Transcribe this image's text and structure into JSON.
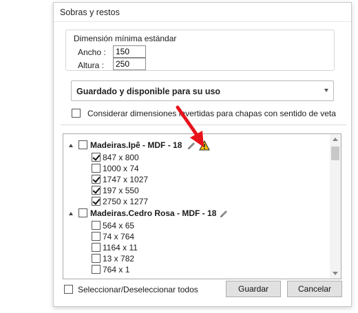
{
  "dialog": {
    "title": "Sobras y restos"
  },
  "min_dim": {
    "legend": "Dimensión mínima estándar",
    "width_label": "Ancho :",
    "width_value": "150",
    "height_label": "Altura :",
    "height_value": "250"
  },
  "storage_select": {
    "value": "Guardado y disponible para su uso"
  },
  "consider_grain": {
    "label": "Considerar dimensiones invertidas para chapas con sentido de veta",
    "checked": false
  },
  "tree": {
    "groups": [
      {
        "label": "Madeiras.Ipê - MDF - 18",
        "checked": false,
        "warning": true,
        "items": [
          {
            "label": "847 x 800",
            "checked": true
          },
          {
            "label": "1000 x 74",
            "checked": false
          },
          {
            "label": "1747 x 1027",
            "checked": true
          },
          {
            "label": "197 x 550",
            "checked": true
          },
          {
            "label": "2750 x 1277",
            "checked": true
          }
        ]
      },
      {
        "label": "Madeiras.Cedro Rosa - MDF - 18",
        "checked": false,
        "warning": false,
        "items": [
          {
            "label": "564 x 65",
            "checked": false
          },
          {
            "label": "74 x 764",
            "checked": false
          },
          {
            "label": "1164 x 11",
            "checked": false
          },
          {
            "label": "13 x 782",
            "checked": false
          },
          {
            "label": "764 x 1",
            "checked": false
          }
        ]
      }
    ]
  },
  "footer": {
    "select_all_label": "Seleccionar/Deseleccionar todos",
    "select_all_checked": false,
    "save_label": "Guardar",
    "cancel_label": "Cancelar"
  },
  "colors": {
    "annotation_arrow": "#e8121b",
    "warning": "#f4c20d"
  },
  "icons": [
    "edit-pencil-icon",
    "warning-icon",
    "expand-triangle-icon",
    "dropdown-arrow-icon"
  ]
}
